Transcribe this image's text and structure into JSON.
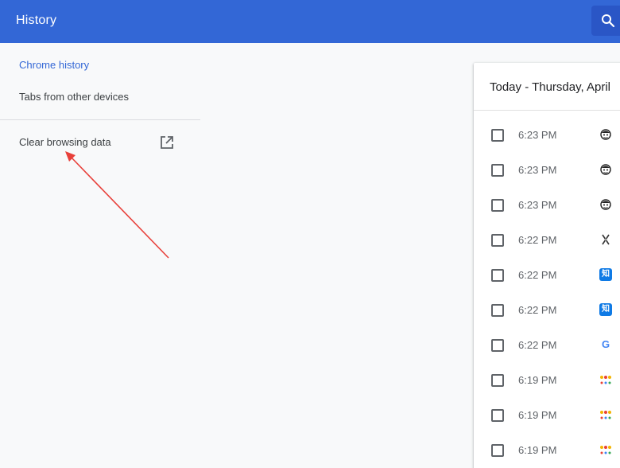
{
  "toolbar": {
    "title": "History"
  },
  "sidebar": {
    "items": [
      {
        "label": "Chrome history"
      },
      {
        "label": "Tabs from other devices"
      },
      {
        "label": "Clear browsing data"
      }
    ]
  },
  "history": {
    "date_header": "Today - Thursday, April",
    "rows": [
      {
        "time": "6:23 PM",
        "favicon": "avatar-icon"
      },
      {
        "time": "6:23 PM",
        "favicon": "avatar-icon"
      },
      {
        "time": "6:23 PM",
        "favicon": "avatar-icon"
      },
      {
        "time": "6:22 PM",
        "favicon": "x-logo-icon"
      },
      {
        "time": "6:22 PM",
        "favicon": "zhihu-icon",
        "favicon_text": "知"
      },
      {
        "time": "6:22 PM",
        "favicon": "zhihu-icon",
        "favicon_text": "知"
      },
      {
        "time": "6:22 PM",
        "favicon": "google-icon",
        "favicon_text": "G"
      },
      {
        "time": "6:19 PM",
        "favicon": "site-icon"
      },
      {
        "time": "6:19 PM",
        "favicon": "site-icon"
      },
      {
        "time": "6:19 PM",
        "favicon": "site-icon"
      }
    ]
  },
  "colors": {
    "toolbar": "#3367d6",
    "accent": "#3367d6",
    "annotation_arrow": "#e8403a"
  }
}
